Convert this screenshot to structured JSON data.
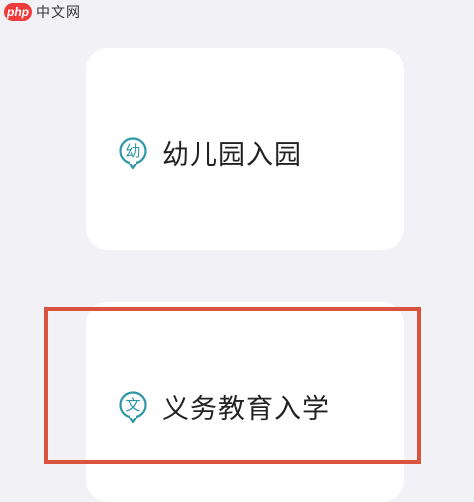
{
  "watermark": {
    "php_label": "php",
    "site_label": "中文网"
  },
  "cards": [
    {
      "icon": "kindergarten-badge-icon",
      "icon_char": "幼",
      "label": "幼儿园入园"
    },
    {
      "icon": "compulsory-education-badge-icon",
      "icon_char": "文",
      "label": "义务教育入学"
    }
  ],
  "colors": {
    "background": "#f2f1f6",
    "card": "#ffffff",
    "icon_accent": "#2d97a8",
    "highlight": "#d9533e"
  }
}
